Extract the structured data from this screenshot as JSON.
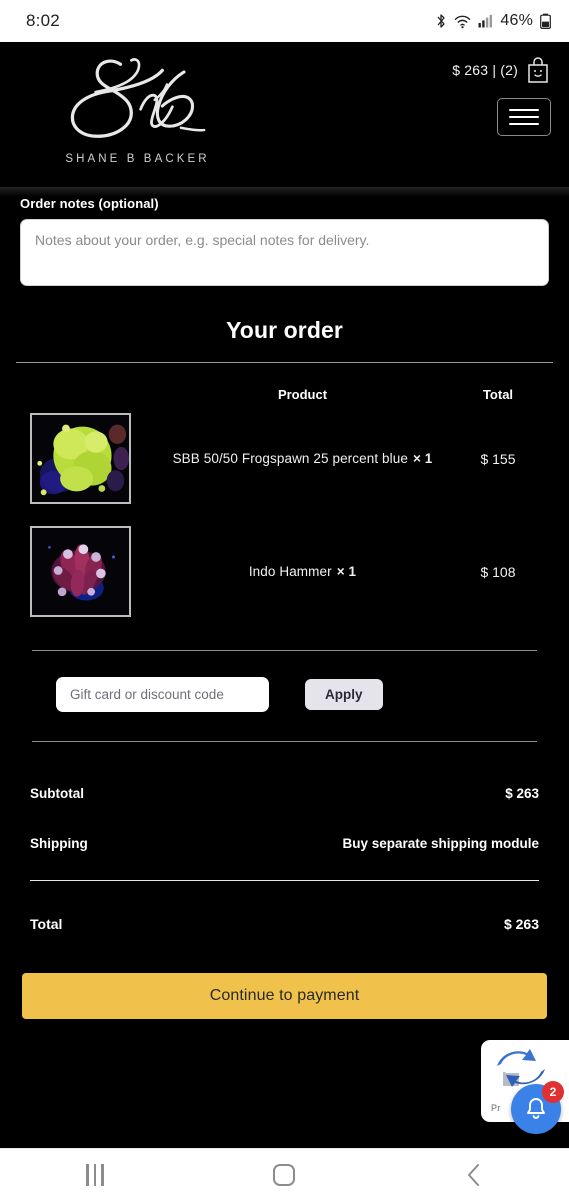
{
  "status_bar": {
    "time": "8:02",
    "battery": "46%",
    "icons": [
      "bluetooth-icon",
      "wifi-icon",
      "cellular-signal-icon",
      "battery-icon"
    ]
  },
  "header": {
    "brand_name": "SHANE B BACKER",
    "logo_monogram": "SBB",
    "cart_text": "$ 263 | (2)",
    "cart_icon": "shopping-bag-icon",
    "menu_icon": "hamburger-menu-icon"
  },
  "order_notes": {
    "label": "Order notes (optional)",
    "placeholder": "Notes about your order, e.g. special notes for delivery.",
    "value": ""
  },
  "order": {
    "title": "Your order",
    "columns": {
      "product": "Product",
      "total": "Total"
    },
    "items": [
      {
        "name": "SBB 50/50 Frogspawn 25 percent blue",
        "qty": "× 1",
        "total": "$ 155",
        "thumb": "frogspawn-coral-thumbnail"
      },
      {
        "name": "Indo Hammer",
        "qty": "× 1",
        "total": "$ 108",
        "thumb": "indo-hammer-coral-thumbnail"
      }
    ]
  },
  "coupon": {
    "placeholder": "Gift card or discount code",
    "value": "",
    "apply_label": "Apply"
  },
  "totals": [
    {
      "label": "Subtotal",
      "value": "$ 263"
    },
    {
      "label": "Shipping",
      "value": "Buy separate shipping module"
    }
  ],
  "grand_total": {
    "label": "Total",
    "value": "$ 263"
  },
  "cta": {
    "label": "Continue to payment"
  },
  "floating_widget": {
    "caption": "Pr",
    "badge_count": "2",
    "logo_icon": "blue-arrows-logo-icon",
    "bell_icon": "bell-icon"
  },
  "nav_bar": {
    "recents_icon": "recents-icon",
    "home_icon": "home-icon",
    "back_icon": "back-chevron-icon"
  },
  "colors": {
    "background": "#000000",
    "cta": "#f0c14b",
    "apply_button": "#e4e4ea",
    "badge": "#e03030",
    "fab_blue": "#3b82e8"
  }
}
